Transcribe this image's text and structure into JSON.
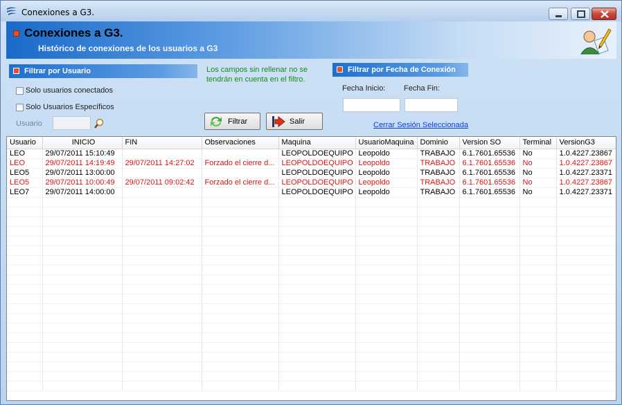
{
  "window": {
    "title": "Conexiones a G3."
  },
  "header": {
    "title": "Conexiones a G3.",
    "subtitle": "Histórico de conexiones de los usuarios a G3"
  },
  "filter_user": {
    "title": "Filtrar por Usuario",
    "only_connected": "Solo usuarios conectados",
    "only_specific": "Solo Usuarios Específicos",
    "user_label": "Usuario",
    "user_value": ""
  },
  "note": "Los campos sin rellenar no se tendrán en cuenta en el filtro.",
  "filter_date": {
    "title": "Filtrar por Fecha de Conexión",
    "start_label": "Fecha Inicio:",
    "end_label": "Fecha Fin:",
    "start_value": "",
    "end_value": ""
  },
  "buttons": {
    "filter": "Filtrar",
    "exit": "Salir"
  },
  "link": "Cerrar Sesión Seleccionada",
  "colors": {
    "highlight_row": "#e01010",
    "header_gradient_start": "#1a6ac9",
    "note_text": "#1b8a1b"
  },
  "table": {
    "columns": [
      "Usuario",
      "INICIO",
      "FIN",
      "Observaciones",
      "Maquina",
      "UsuarioMaquina",
      "Dominio",
      "Version SO",
      "Terminal",
      "VersionG3"
    ],
    "rows": [
      {
        "highlight": false,
        "cells": [
          "LEO",
          "29/07/2011 15:10:49",
          "",
          "",
          "LEOPOLDOEQUIPO",
          "Leopoldo",
          "TRABAJO",
          "6.1.7601.65536",
          "No",
          "1.0.4227.23867"
        ]
      },
      {
        "highlight": true,
        "cells": [
          "LEO",
          "29/07/2011 14:19:49",
          "29/07/2011 14:27:02",
          "Forzado el cierre d...",
          "LEOPOLDOEQUIPO",
          "Leopoldo",
          "TRABAJO",
          "6.1.7601.65536",
          "No",
          "1.0.4227.23867"
        ]
      },
      {
        "highlight": false,
        "cells": [
          "LEO5",
          "29/07/2011 13:00:00",
          "",
          "",
          "LEOPOLDOEQUIPO",
          "Leopoldo",
          "TRABAJO",
          "6.1.7601.65536",
          "No",
          "1.0.4227.23371"
        ]
      },
      {
        "highlight": true,
        "cells": [
          "LEO5",
          "29/07/2011 10:00:49",
          "29/07/2011 09:02:42",
          "Forzado el cierre d...",
          "LEOPOLDOEQUIPO",
          "Leopoldo",
          "TRABAJO",
          "6.1.7601.65536",
          "No",
          "1.0.4227.23867"
        ]
      },
      {
        "highlight": false,
        "cells": [
          "LEO7",
          "29/07/2011 14:00:00",
          "",
          "",
          "LEOPOLDOEQUIPO",
          "Leopoldo",
          "TRABAJO",
          "6.1.7601.65536",
          "No",
          "1.0.4227.23371"
        ]
      }
    ]
  }
}
